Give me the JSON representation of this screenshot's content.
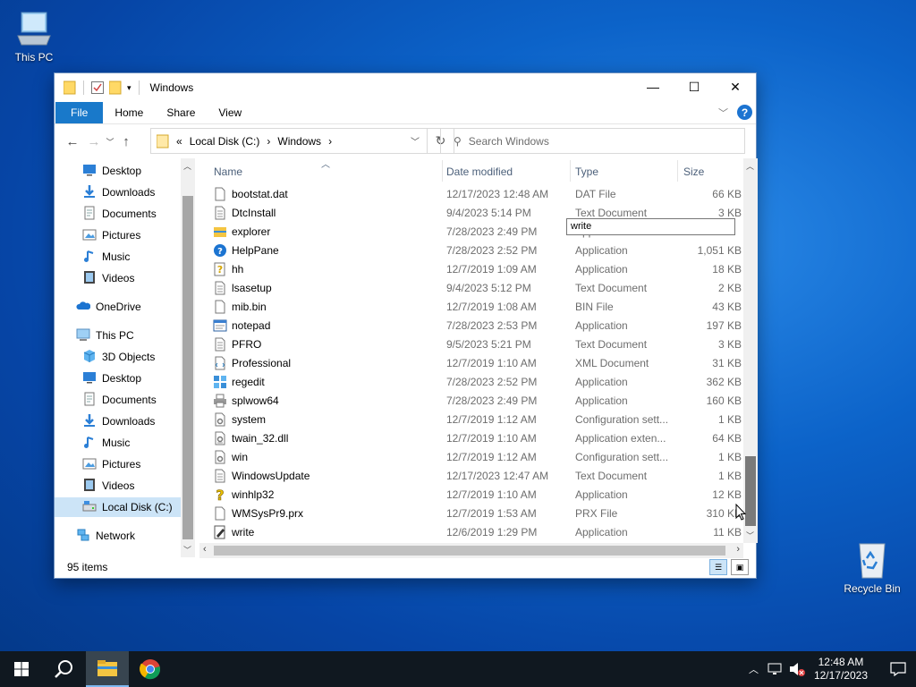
{
  "desktop": {
    "this_pc_label": "This PC",
    "recycle_bin_label": "Recycle Bin"
  },
  "window": {
    "title": "Windows",
    "ribbon_tabs": [
      "File",
      "Home",
      "Share",
      "View"
    ],
    "address": {
      "prefix": "«",
      "crumbs": [
        "Local Disk (C:)",
        "Windows"
      ],
      "separator": "›"
    },
    "search_placeholder": "Search Windows",
    "nav_pane": {
      "quick_access": [
        {
          "label": "Desktop",
          "icon": "desktop-icon",
          "pinned": true
        },
        {
          "label": "Downloads",
          "icon": "downloads-icon",
          "pinned": true
        },
        {
          "label": "Documents",
          "icon": "documents-icon",
          "pinned": true
        },
        {
          "label": "Pictures",
          "icon": "pictures-icon",
          "pinned": true
        },
        {
          "label": "Music",
          "icon": "music-icon",
          "pinned": false
        },
        {
          "label": "Videos",
          "icon": "videos-icon",
          "pinned": false
        }
      ],
      "onedrive": "OneDrive",
      "this_pc": "This PC",
      "this_pc_items": [
        {
          "label": "3D Objects",
          "icon": "3d-objects-icon"
        },
        {
          "label": "Desktop",
          "icon": "desktop-icon"
        },
        {
          "label": "Documents",
          "icon": "documents-icon"
        },
        {
          "label": "Downloads",
          "icon": "downloads-icon"
        },
        {
          "label": "Music",
          "icon": "music-icon"
        },
        {
          "label": "Pictures",
          "icon": "pictures-icon"
        },
        {
          "label": "Videos",
          "icon": "videos-icon"
        },
        {
          "label": "Local Disk (C:)",
          "icon": "drive-icon",
          "selected": true
        }
      ],
      "network": "Network"
    },
    "columns": {
      "name": "Name",
      "date": "Date modified",
      "type": "Type",
      "size": "Size"
    },
    "files": [
      {
        "name": "bootstat.dat",
        "date": "12/17/2023 12:48 AM",
        "type": "DAT File",
        "size": "66 KB",
        "icon": "file-icon"
      },
      {
        "name": "DtcInstall",
        "date": "9/4/2023 5:14 PM",
        "type": "Text Document",
        "size": "3 KB",
        "icon": "text-file-icon"
      },
      {
        "name": "explorer",
        "date": "7/28/2023 2:49 PM",
        "type": "Application",
        "size": "",
        "icon": "folder-app-icon"
      },
      {
        "name": "HelpPane",
        "date": "7/28/2023 2:52 PM",
        "type": "Application",
        "size": "1,051 KB",
        "icon": "help-icon"
      },
      {
        "name": "hh",
        "date": "12/7/2019 1:09 AM",
        "type": "Application",
        "size": "18 KB",
        "icon": "help-doc-icon"
      },
      {
        "name": "lsasetup",
        "date": "9/4/2023 5:12 PM",
        "type": "Text Document",
        "size": "2 KB",
        "icon": "text-file-icon"
      },
      {
        "name": "mib.bin",
        "date": "12/7/2019 1:08 AM",
        "type": "BIN File",
        "size": "43 KB",
        "icon": "file-icon"
      },
      {
        "name": "notepad",
        "date": "7/28/2023 2:53 PM",
        "type": "Application",
        "size": "197 KB",
        "icon": "notepad-icon"
      },
      {
        "name": "PFRO",
        "date": "9/5/2023 5:21 PM",
        "type": "Text Document",
        "size": "3 KB",
        "icon": "text-file-icon"
      },
      {
        "name": "Professional",
        "date": "12/7/2019 1:10 AM",
        "type": "XML Document",
        "size": "31 KB",
        "icon": "xml-file-icon"
      },
      {
        "name": "regedit",
        "date": "7/28/2023 2:52 PM",
        "type": "Application",
        "size": "362 KB",
        "icon": "regedit-icon"
      },
      {
        "name": "splwow64",
        "date": "7/28/2023 2:49 PM",
        "type": "Application",
        "size": "160 KB",
        "icon": "printer-icon"
      },
      {
        "name": "system",
        "date": "12/7/2019 1:12 AM",
        "type": "Configuration sett...",
        "size": "1 KB",
        "icon": "config-file-icon"
      },
      {
        "name": "twain_32.dll",
        "date": "12/7/2019 1:10 AM",
        "type": "Application exten...",
        "size": "64 KB",
        "icon": "dll-file-icon"
      },
      {
        "name": "win",
        "date": "12/7/2019 1:12 AM",
        "type": "Configuration sett...",
        "size": "1 KB",
        "icon": "config-file-icon"
      },
      {
        "name": "WindowsUpdate",
        "date": "12/17/2023 12:47 AM",
        "type": "Text Document",
        "size": "1 KB",
        "icon": "text-file-icon"
      },
      {
        "name": "winhlp32",
        "date": "12/7/2019 1:10 AM",
        "type": "Application",
        "size": "12 KB",
        "icon": "help-question-icon"
      },
      {
        "name": "WMSysPr9.prx",
        "date": "12/7/2019 1:53 AM",
        "type": "PRX File",
        "size": "310 KB",
        "icon": "file-icon"
      },
      {
        "name": "write",
        "date": "12/6/2019 1:29 PM",
        "type": "Application",
        "size": "11 KB",
        "icon": "write-icon"
      }
    ],
    "tooltip": "write",
    "status": "95 items"
  },
  "taskbar": {
    "time": "12:48 AM",
    "date": "12/17/2023"
  }
}
